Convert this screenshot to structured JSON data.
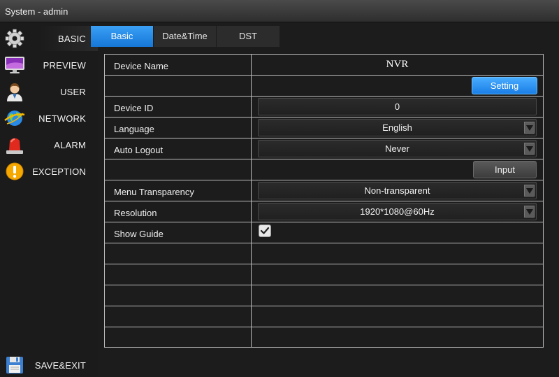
{
  "window": {
    "title": "System - admin"
  },
  "sidebar": {
    "items": [
      {
        "label": "BASIC",
        "icon": "gear-icon"
      },
      {
        "label": "PREVIEW",
        "icon": "monitor-icon"
      },
      {
        "label": "USER",
        "icon": "user-icon"
      },
      {
        "label": "NETWORK",
        "icon": "globe-icon"
      },
      {
        "label": "ALARM",
        "icon": "alarm-icon"
      },
      {
        "label": "EXCEPTION",
        "icon": "warning-icon"
      }
    ],
    "save_exit": {
      "label": "SAVE&EXIT",
      "icon": "floppy-disk-icon"
    }
  },
  "tabs": [
    {
      "label": "Basic",
      "active": true
    },
    {
      "label": "Date&Time",
      "active": false
    },
    {
      "label": "DST",
      "active": false
    }
  ],
  "form": {
    "device_name": {
      "label": "Device Name",
      "value": "NVR"
    },
    "setting_button": "Setting",
    "device_id": {
      "label": "Device ID",
      "value": "0"
    },
    "language": {
      "label": "Language",
      "value": "English"
    },
    "auto_logout": {
      "label": "Auto Logout",
      "value": "Never"
    },
    "input_button": "Input",
    "menu_transparency": {
      "label": "Menu Transparency",
      "value": "Non-transparent"
    },
    "resolution": {
      "label": "Resolution",
      "value": "1920*1080@60Hz"
    },
    "show_guide": {
      "label": "Show Guide",
      "checked": true
    }
  },
  "colors": {
    "accent": "#1a7ee6",
    "background": "#1c1c1c",
    "grid_line": "#bdbdbd"
  }
}
